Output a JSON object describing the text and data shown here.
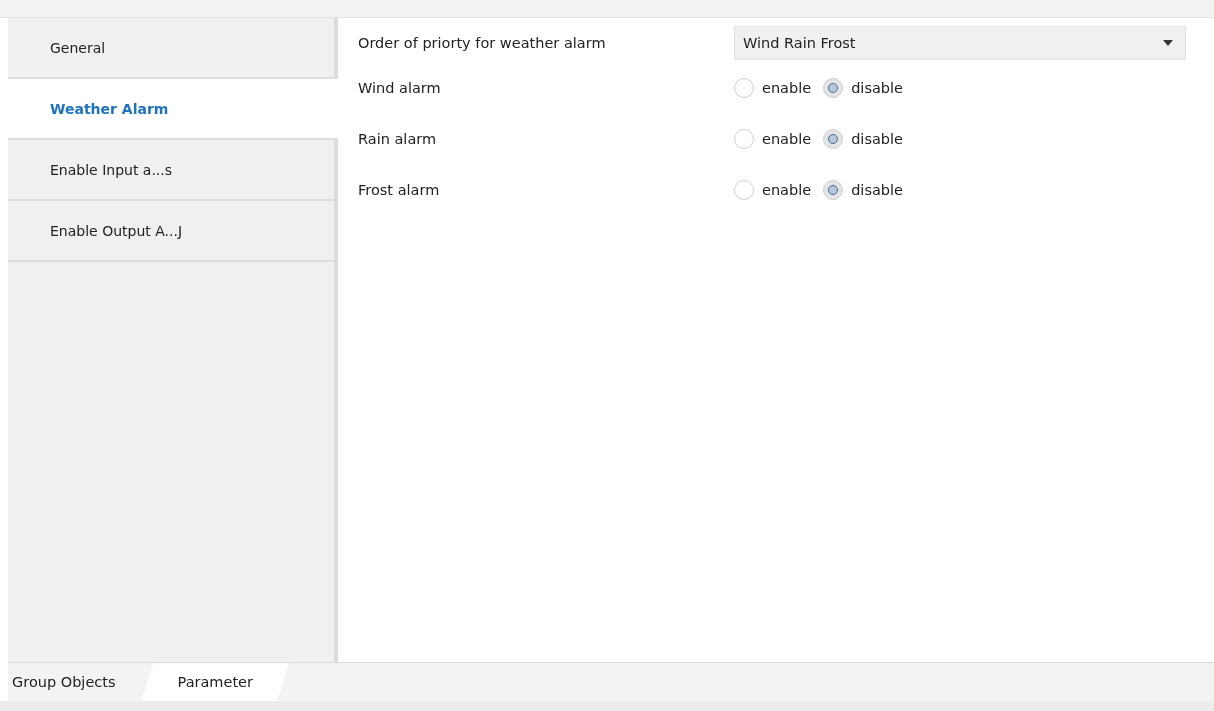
{
  "sidebar": {
    "items": [
      {
        "label": "General",
        "selected": false
      },
      {
        "label": "Weather Alarm",
        "selected": true
      },
      {
        "label": "Enable Input a...s",
        "selected": false
      },
      {
        "label": "Enable Output A...J",
        "selected": false
      }
    ]
  },
  "parameters": [
    {
      "kind": "dropdown",
      "label": "Order of priorty for weather alarm",
      "value": "Wind Rain Frost"
    },
    {
      "kind": "radio",
      "label": "Wind alarm",
      "options": [
        {
          "label": "enable",
          "selected": false
        },
        {
          "label": "disable",
          "selected": true
        }
      ]
    },
    {
      "kind": "radio",
      "label": "Rain alarm",
      "options": [
        {
          "label": "enable",
          "selected": false
        },
        {
          "label": "disable",
          "selected": true
        }
      ]
    },
    {
      "kind": "radio",
      "label": "Frost alarm",
      "options": [
        {
          "label": "enable",
          "selected": false
        },
        {
          "label": "disable",
          "selected": true
        }
      ]
    }
  ],
  "bottom_tabs": [
    {
      "label": "Group Objects",
      "selected": false
    },
    {
      "label": "Parameter",
      "selected": true
    }
  ]
}
